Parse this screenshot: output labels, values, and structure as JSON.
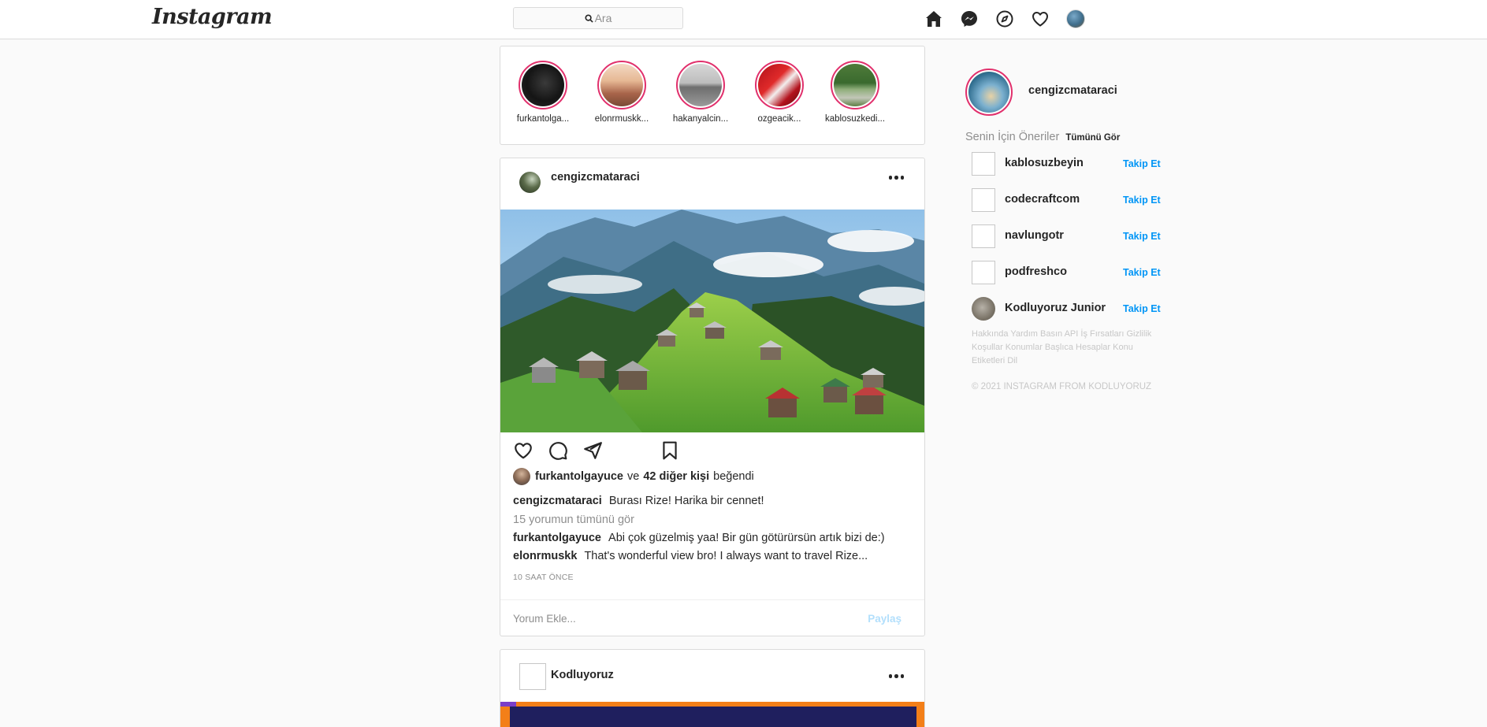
{
  "header": {
    "logo": "Instagram",
    "search_placeholder": "Ara",
    "nav": [
      "home-icon",
      "messenger-icon",
      "explore-icon",
      "heart-icon",
      "profile-avatar"
    ]
  },
  "stories": [
    {
      "name": "furkantolga..."
    },
    {
      "name": "elonrmuskk..."
    },
    {
      "name": "hakanyalcin..."
    },
    {
      "name": "ozgeacik..."
    },
    {
      "name": "kablosuzkedi..."
    }
  ],
  "post": {
    "username": "cengizcmataraci",
    "likes": {
      "liker": "furkantolgayuce",
      "conj": "ve",
      "others": "42 diğer kişi",
      "suffix": "beğendi"
    },
    "caption": {
      "user": "cengizcmataraci",
      "text": "Burası Rize! Harika bir cennet!"
    },
    "view_all": "15 yorumun tümünü gör",
    "comments": [
      {
        "user": "furkantolgayuce",
        "text": "Abi çok güzelmiş yaa! Bir gün götürürsün artık bizi de:)"
      },
      {
        "user": "elonrmuskk",
        "text": "That's wonderful view bro! I always want to travel Rize..."
      }
    ],
    "time": "10 SAAT ÖNCE",
    "comment_placeholder": "Yorum Ekle...",
    "share_label": "Paylaş"
  },
  "post2": {
    "username": "Kodluyoruz"
  },
  "sidebar": {
    "username": "cengizcmataraci",
    "suggestions_title": "Senin İçin Öneriler",
    "see_all": "Tümünü Gör",
    "follow_label": "Takip Et",
    "suggestions": [
      {
        "name": "kablosuzbeyin"
      },
      {
        "name": "codecraftcom"
      },
      {
        "name": "navlungotr"
      },
      {
        "name": "podfreshco"
      },
      {
        "name": "Kodluyoruz Junior"
      }
    ],
    "footer_links": "Hakkında Yardım Basın API İş Fırsatları Gizlilik Koşullar Konumlar Başlıca Hesaplar Konu Etiketleri Dil",
    "copyright": "© 2021 INSTAGRAM FROM KODLUYORUZ"
  },
  "colors": {
    "story_ring": "#e1306c",
    "follow": "#0095f6",
    "share_disabled": "#b2dffc"
  }
}
